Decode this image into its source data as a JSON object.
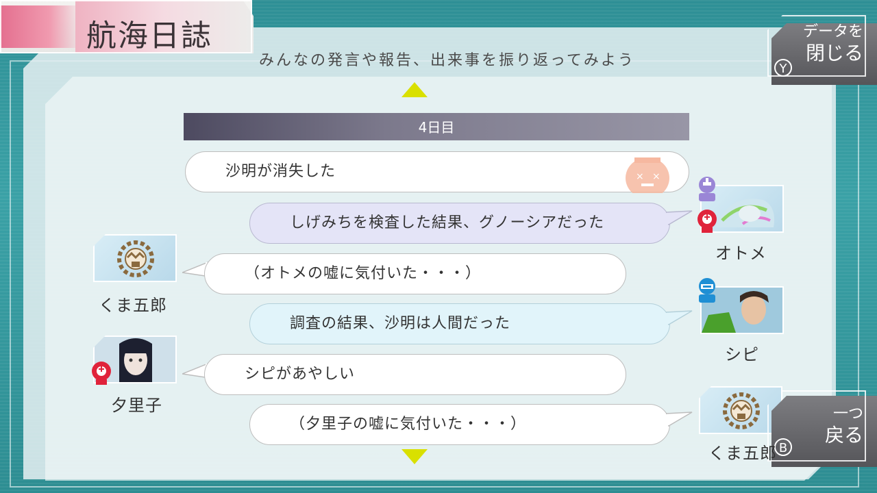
{
  "title": "航海日誌",
  "subtitle": "みんなの発言や報告、出来事を振り返ってみよう",
  "day_header": "4日目",
  "close_button": {
    "line1": "データを",
    "line2": "閉じる",
    "key": "Y"
  },
  "back_button": {
    "line1": "一つ",
    "line2": "戻る",
    "key": "B"
  },
  "entries": [
    {
      "text": "沙明が消失した",
      "speaker": "",
      "style": "event"
    },
    {
      "text": "しげみちを検査した結果、グノーシアだった",
      "speaker": "オトメ",
      "style": "report"
    },
    {
      "text": "（オトメの嘘に気付いた・・・）",
      "speaker": "くま五郎",
      "style": "thought"
    },
    {
      "text": "調査の結果、沙明は人間だった",
      "speaker": "シピ",
      "style": "report-blue"
    },
    {
      "text": "シピがあやしい",
      "speaker": "夕里子",
      "style": "statement"
    },
    {
      "text": "（夕里子の嘘に気付いた・・・）",
      "speaker": "くま五郎",
      "style": "thought"
    }
  ],
  "colors": {
    "accent_pink": "#e46f8f",
    "arrow": "#d9e000",
    "report_bubble": "#e4e4f7",
    "blue_bubble": "#e1f4fa"
  }
}
